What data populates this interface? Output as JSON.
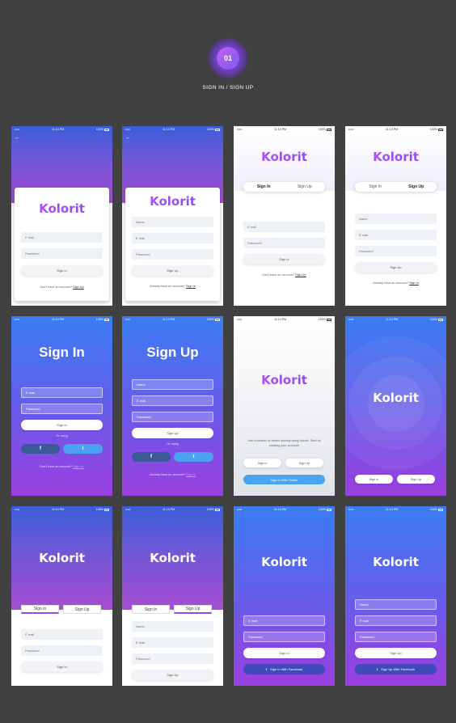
{
  "header": {
    "step": "01",
    "title": "SIGN IN / SIGN UP"
  },
  "status": {
    "carrier": "•••••",
    "time": "11:14 PM",
    "battery": "100%"
  },
  "brand": "Kolorit",
  "labels": {
    "email": "E mail",
    "password": "Password",
    "name": "Name",
    "sign_in": "Sign In",
    "sign_up": "Sign Up",
    "no_account": "Don't have an account?",
    "have_account": "Already have an account?",
    "or_using": "Or using",
    "facebook": "f",
    "twitter": "t",
    "sign_in_twitter": "Sign In With Twitter",
    "sign_in_facebook": "Sign In With Facebook",
    "sign_up_facebook": "Sign Up With Facebook",
    "tagline": "Join hundreds of others already using Kolorit. Start by creating your account!"
  },
  "colors": {
    "accent": "#8b4fe6",
    "facebook": "#3b5998",
    "twitter": "#4aa3f0"
  }
}
